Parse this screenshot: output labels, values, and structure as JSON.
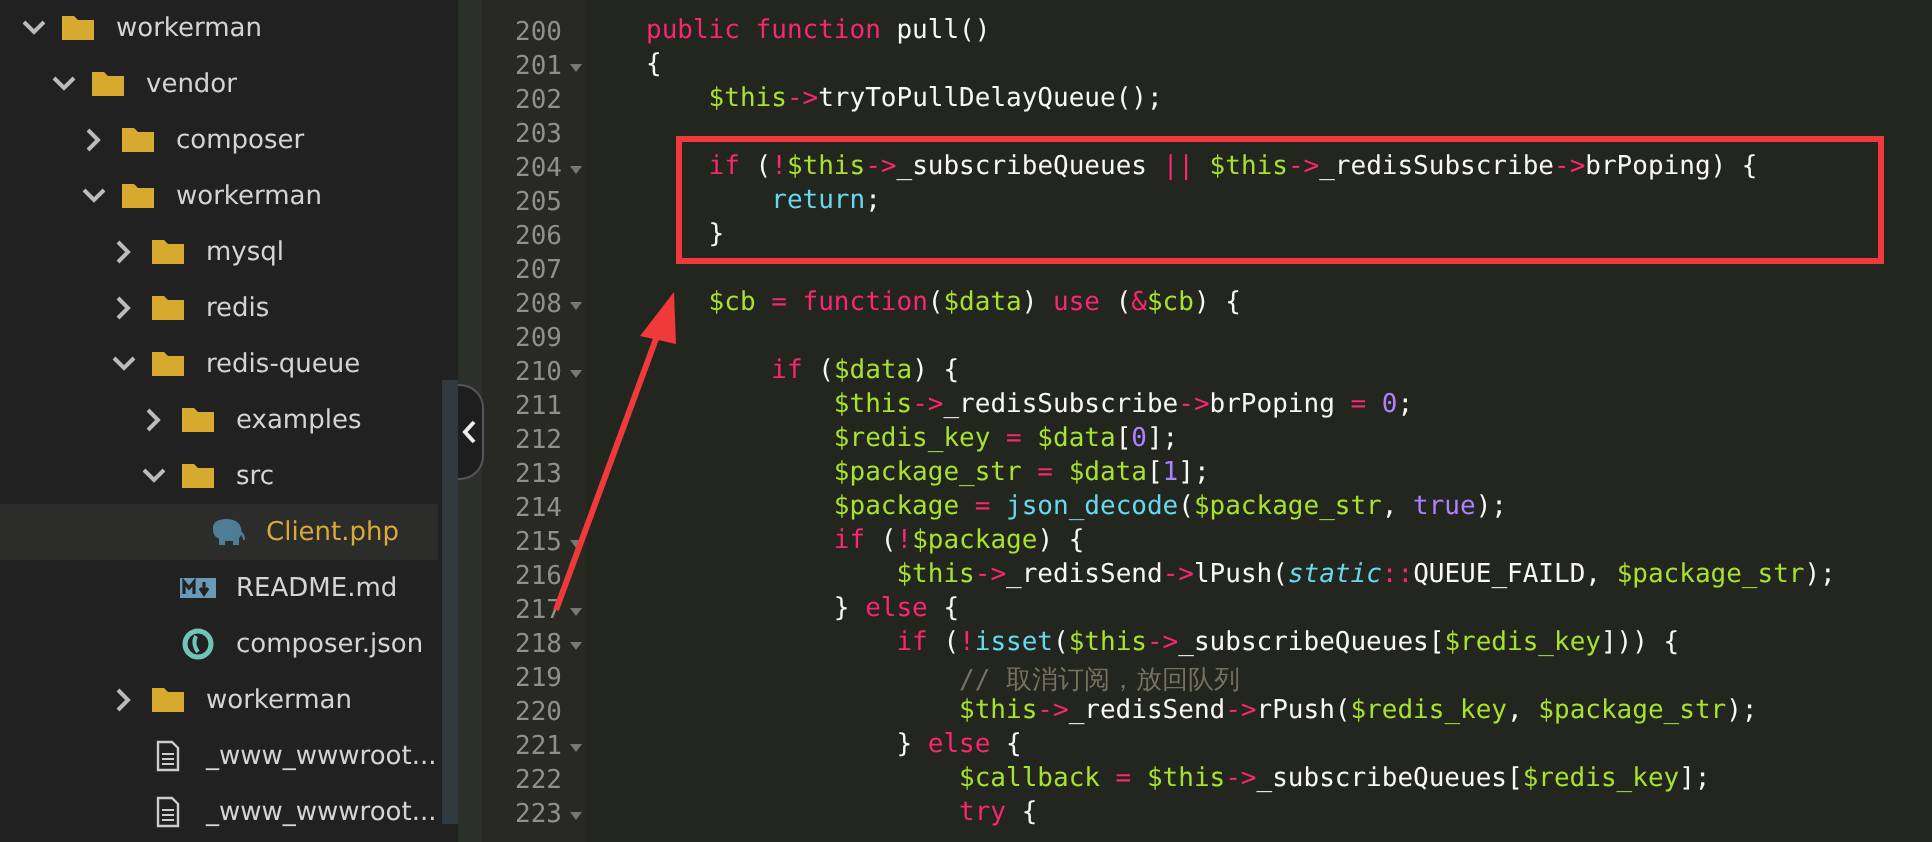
{
  "file_tree": [
    {
      "name": "workerman",
      "kind": "folder",
      "expanded": true,
      "selected": false,
      "children": [
        {
          "name": "vendor",
          "kind": "folder",
          "expanded": true,
          "selected": false,
          "children": [
            {
              "name": "composer",
              "kind": "folder",
              "expanded": false,
              "selected": false
            },
            {
              "name": "workerman",
              "kind": "folder",
              "expanded": true,
              "selected": false,
              "children": [
                {
                  "name": "mysql",
                  "kind": "folder",
                  "expanded": false,
                  "selected": false
                },
                {
                  "name": "redis",
                  "kind": "folder",
                  "expanded": false,
                  "selected": false
                },
                {
                  "name": "redis-queue",
                  "kind": "folder",
                  "expanded": true,
                  "selected": false,
                  "children": [
                    {
                      "name": "examples",
                      "kind": "folder",
                      "expanded": false,
                      "selected": false
                    },
                    {
                      "name": "src",
                      "kind": "folder",
                      "expanded": true,
                      "selected": false,
                      "children": [
                        {
                          "name": "Client.php",
                          "kind": "php",
                          "selected": true
                        }
                      ]
                    },
                    {
                      "name": "README.md",
                      "kind": "markdown",
                      "selected": false
                    },
                    {
                      "name": "composer.json",
                      "kind": "json",
                      "selected": false
                    }
                  ]
                },
                {
                  "name": "workerman",
                  "kind": "folder",
                  "expanded": false,
                  "selected": false
                },
                {
                  "name": "_www_wwwroot...",
                  "kind": "file",
                  "selected": false
                },
                {
                  "name": "_www_wwwroot...",
                  "kind": "file",
                  "selected": false
                }
              ]
            }
          ]
        }
      ]
    }
  ],
  "code_lines": [
    {
      "number": "200",
      "fold": false,
      "tokens": [
        {
          "kind": "kw",
          "text": "public function"
        },
        {
          "kind": "pl",
          "text": " pull()"
        }
      ]
    },
    {
      "number": "201",
      "fold": true,
      "tokens": [
        {
          "kind": "pl",
          "text": "{"
        }
      ]
    },
    {
      "number": "202",
      "fold": false,
      "tokens": [
        {
          "kind": "var",
          "text": "    $this"
        },
        {
          "kind": "kw",
          "text": "->"
        },
        {
          "kind": "pl",
          "text": "tryToPullDelayQueue();"
        }
      ]
    },
    {
      "number": "203",
      "fold": false
    },
    {
      "number": "204",
      "fold": true,
      "tokens": [
        {
          "kind": "kw",
          "text": "    if"
        },
        {
          "kind": "pl",
          "text": " ("
        },
        {
          "kind": "kw",
          "text": "!"
        },
        {
          "kind": "var",
          "text": "$this"
        },
        {
          "kind": "kw",
          "text": "->"
        },
        {
          "kind": "pl",
          "text": "_subscribeQueues "
        },
        {
          "kind": "kw",
          "text": "||"
        },
        {
          "kind": "var",
          "text": " $this"
        },
        {
          "kind": "kw",
          "text": "->"
        },
        {
          "kind": "pl",
          "text": "_redisSubscribe"
        },
        {
          "kind": "kw",
          "text": "->"
        },
        {
          "kind": "pl",
          "text": "brPoping) {"
        }
      ]
    },
    {
      "number": "205",
      "fold": false,
      "tokens": [
        {
          "kind": "fn",
          "text": "        return"
        },
        {
          "kind": "pl",
          "text": ";"
        }
      ]
    },
    {
      "number": "206",
      "fold": false,
      "tokens": [
        {
          "kind": "pl",
          "text": "    }"
        }
      ]
    },
    {
      "number": "207",
      "fold": false
    },
    {
      "number": "208",
      "fold": true,
      "tokens": [
        {
          "kind": "var",
          "text": "    $cb"
        },
        {
          "kind": "kw",
          "text": " = function"
        },
        {
          "kind": "pl",
          "text": "("
        },
        {
          "kind": "var",
          "text": "$data"
        },
        {
          "kind": "pl",
          "text": ") "
        },
        {
          "kind": "kw",
          "text": "use"
        },
        {
          "kind": "pl",
          "text": " ("
        },
        {
          "kind": "kw",
          "text": "&"
        },
        {
          "kind": "var",
          "text": "$cb"
        },
        {
          "kind": "pl",
          "text": ") {"
        }
      ]
    },
    {
      "number": "209",
      "fold": false
    },
    {
      "number": "210",
      "fold": true,
      "tokens": [
        {
          "kind": "kw",
          "text": "        if"
        },
        {
          "kind": "pl",
          "text": " ("
        },
        {
          "kind": "var",
          "text": "$data"
        },
        {
          "kind": "pl",
          "text": ") {"
        }
      ]
    },
    {
      "number": "211",
      "fold": false,
      "tokens": [
        {
          "kind": "var",
          "text": "            $this"
        },
        {
          "kind": "kw",
          "text": "->"
        },
        {
          "kind": "pl",
          "text": "_redisSubscribe"
        },
        {
          "kind": "kw",
          "text": "->"
        },
        {
          "kind": "pl",
          "text": "brPoping"
        },
        {
          "kind": "kw",
          "text": " = "
        },
        {
          "kind": "num",
          "text": "0"
        },
        {
          "kind": "pl",
          "text": ";"
        }
      ]
    },
    {
      "number": "212",
      "fold": false,
      "tokens": [
        {
          "kind": "var",
          "text": "            $redis_key"
        },
        {
          "kind": "kw",
          "text": " = "
        },
        {
          "kind": "var",
          "text": "$data"
        },
        {
          "kind": "pl",
          "text": "["
        },
        {
          "kind": "num",
          "text": "0"
        },
        {
          "kind": "pl",
          "text": "];"
        }
      ]
    },
    {
      "number": "213",
      "fold": false,
      "tokens": [
        {
          "kind": "var",
          "text": "            $package_str"
        },
        {
          "kind": "kw",
          "text": " = "
        },
        {
          "kind": "var",
          "text": "$data"
        },
        {
          "kind": "pl",
          "text": "["
        },
        {
          "kind": "num",
          "text": "1"
        },
        {
          "kind": "pl",
          "text": "];"
        }
      ]
    },
    {
      "number": "214",
      "fold": false,
      "tokens": [
        {
          "kind": "var",
          "text": "            $package"
        },
        {
          "kind": "kw",
          "text": " = "
        },
        {
          "kind": "fn",
          "text": "json_decode"
        },
        {
          "kind": "pl",
          "text": "("
        },
        {
          "kind": "var",
          "text": "$package_str"
        },
        {
          "kind": "pl",
          "text": ", "
        },
        {
          "kind": "num",
          "text": "true"
        },
        {
          "kind": "pl",
          "text": ");"
        }
      ]
    },
    {
      "number": "215",
      "fold": true,
      "tokens": [
        {
          "kind": "kw",
          "text": "            if"
        },
        {
          "kind": "pl",
          "text": " ("
        },
        {
          "kind": "kw",
          "text": "!"
        },
        {
          "kind": "var",
          "text": "$package"
        },
        {
          "kind": "pl",
          "text": ") {"
        }
      ]
    },
    {
      "number": "216",
      "fold": false,
      "tokens": [
        {
          "kind": "var",
          "text": "                $this"
        },
        {
          "kind": "kw",
          "text": "->"
        },
        {
          "kind": "pl",
          "text": "_redisSend"
        },
        {
          "kind": "kw",
          "text": "->"
        },
        {
          "kind": "pl",
          "text": "lPush("
        },
        {
          "kind": "it",
          "text": "static"
        },
        {
          "kind": "kw",
          "text": "::"
        },
        {
          "kind": "pl",
          "text": "QUEUE_FAILD, "
        },
        {
          "kind": "var",
          "text": "$package_str"
        },
        {
          "kind": "pl",
          "text": ");"
        }
      ]
    },
    {
      "number": "217",
      "fold": true,
      "tokens": [
        {
          "kind": "pl",
          "text": "            } "
        },
        {
          "kind": "kw",
          "text": "else"
        },
        {
          "kind": "pl",
          "text": " {"
        }
      ]
    },
    {
      "number": "218",
      "fold": true,
      "tokens": [
        {
          "kind": "kw",
          "text": "                if"
        },
        {
          "kind": "pl",
          "text": " ("
        },
        {
          "kind": "kw",
          "text": "!"
        },
        {
          "kind": "fn",
          "text": "isset"
        },
        {
          "kind": "pl",
          "text": "("
        },
        {
          "kind": "var",
          "text": "$this"
        },
        {
          "kind": "kw",
          "text": "->"
        },
        {
          "kind": "pl",
          "text": "_subscribeQueues["
        },
        {
          "kind": "var",
          "text": "$redis_key"
        },
        {
          "kind": "pl",
          "text": "])) {"
        }
      ]
    },
    {
      "number": "219",
      "fold": false,
      "tokens": [
        {
          "kind": "cm",
          "text": "                    // 取消订阅，放回队列"
        }
      ]
    },
    {
      "number": "220",
      "fold": false,
      "tokens": [
        {
          "kind": "var",
          "text": "                    $this"
        },
        {
          "kind": "kw",
          "text": "->"
        },
        {
          "kind": "pl",
          "text": "_redisSend"
        },
        {
          "kind": "kw",
          "text": "->"
        },
        {
          "kind": "pl",
          "text": "rPush("
        },
        {
          "kind": "var",
          "text": "$redis_key"
        },
        {
          "kind": "pl",
          "text": ", "
        },
        {
          "kind": "var",
          "text": "$package_str"
        },
        {
          "kind": "pl",
          "text": ");"
        }
      ]
    },
    {
      "number": "221",
      "fold": true,
      "tokens": [
        {
          "kind": "pl",
          "text": "                } "
        },
        {
          "kind": "kw",
          "text": "else"
        },
        {
          "kind": "pl",
          "text": " {"
        }
      ]
    },
    {
      "number": "222",
      "fold": false,
      "tokens": [
        {
          "kind": "var",
          "text": "                    $callback"
        },
        {
          "kind": "kw",
          "text": " = "
        },
        {
          "kind": "var",
          "text": "$this"
        },
        {
          "kind": "kw",
          "text": "->"
        },
        {
          "kind": "pl",
          "text": "_subscribeQueues["
        },
        {
          "kind": "var",
          "text": "$redis_key"
        },
        {
          "kind": "pl",
          "text": "];"
        }
      ]
    },
    {
      "number": "223",
      "fold": true,
      "tokens": [
        {
          "kind": "kw",
          "text": "                    try"
        },
        {
          "kind": "pl",
          "text": " {"
        }
      ]
    }
  ]
}
